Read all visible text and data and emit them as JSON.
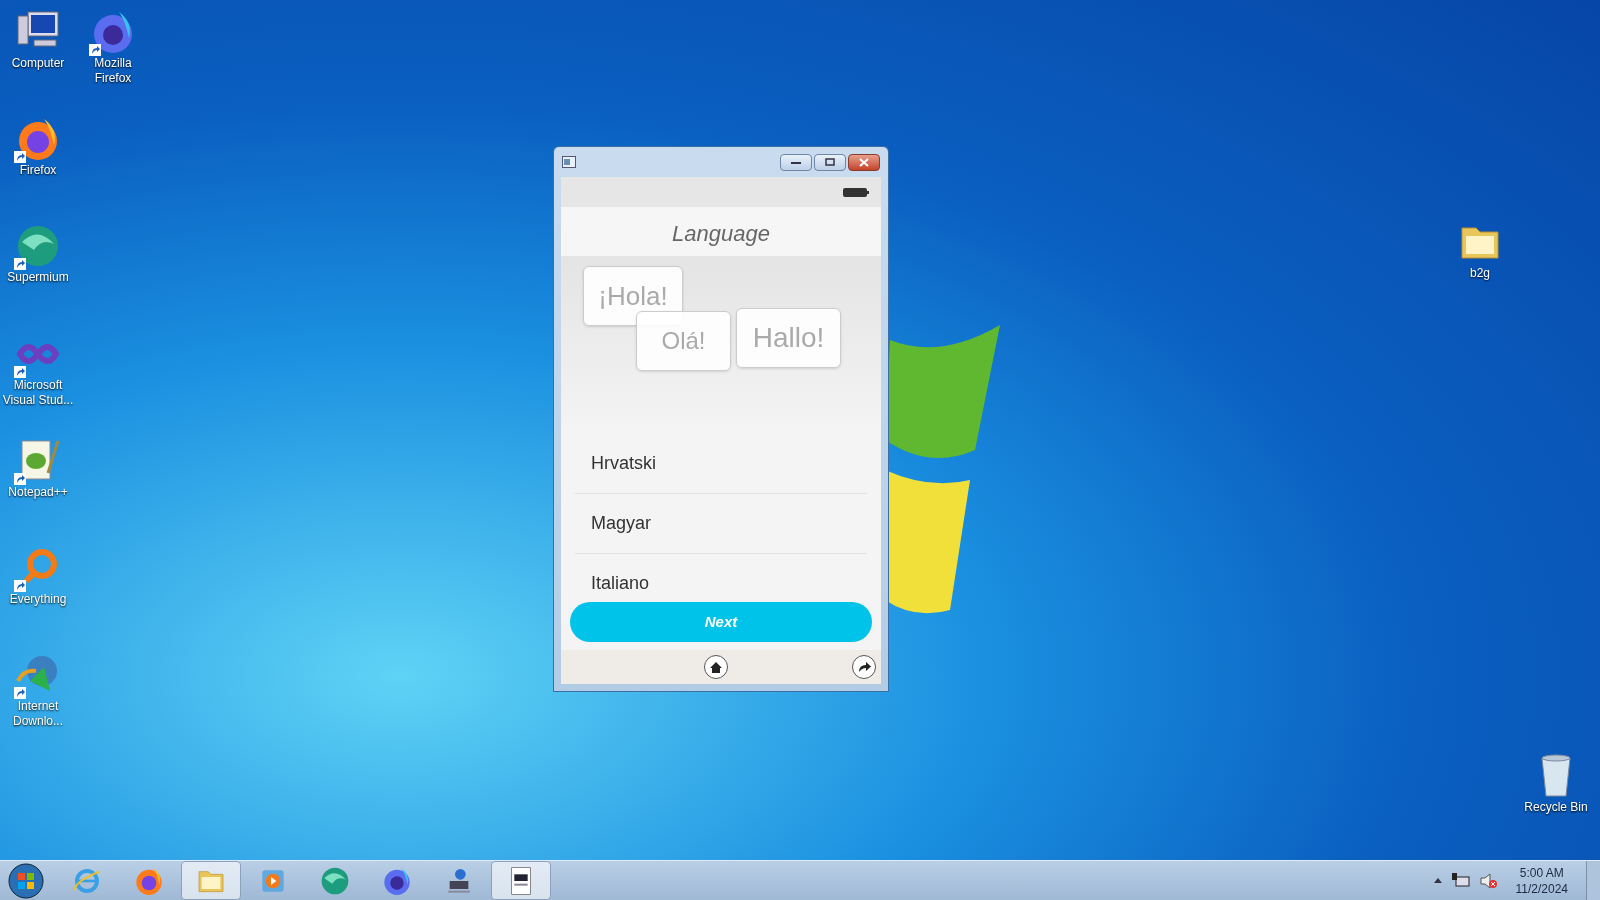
{
  "desktop_icons": [
    {
      "label": "Computer",
      "kind": "computer",
      "shortcut": false
    },
    {
      "label": "Mozilla Firefox",
      "kind": "firefox-blue",
      "shortcut": true
    },
    {
      "label": "Firefox",
      "kind": "firefox",
      "shortcut": true
    },
    {
      "label": "Supermium",
      "kind": "supermium",
      "shortcut": true
    },
    {
      "label": "Microsoft Visual Stud...",
      "kind": "vs",
      "shortcut": true
    },
    {
      "label": "Notepad++",
      "kind": "notepad",
      "shortcut": true
    },
    {
      "label": "Everything",
      "kind": "everything",
      "shortcut": true
    },
    {
      "label": "Internet Downlo...",
      "kind": "idm",
      "shortcut": true
    },
    {
      "label": "b2g",
      "kind": "folder",
      "shortcut": false
    },
    {
      "label": "Recycle Bin",
      "kind": "recycle",
      "shortcut": false
    }
  ],
  "window": {
    "header": "Language",
    "greetings": [
      "¡Hola!",
      "Olá!",
      "Hallo!"
    ],
    "languages": [
      "Hrvatski",
      "Magyar",
      "Italiano"
    ],
    "next_button": "Next"
  },
  "taskbar": {
    "items": [
      {
        "kind": "ie",
        "active": false
      },
      {
        "kind": "firefox",
        "active": false
      },
      {
        "kind": "folder",
        "active": true
      },
      {
        "kind": "media",
        "active": false
      },
      {
        "kind": "supermium",
        "active": false
      },
      {
        "kind": "firefox-blue",
        "active": false
      },
      {
        "kind": "network",
        "active": false
      },
      {
        "kind": "app",
        "active": true
      }
    ],
    "time": "5:00 AM",
    "date": "11/2/2024"
  }
}
